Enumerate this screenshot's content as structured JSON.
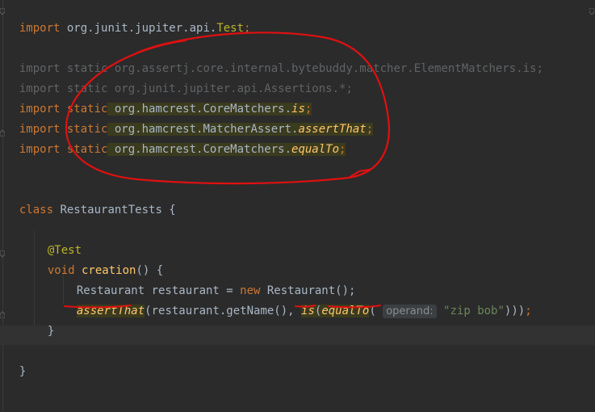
{
  "editor": {
    "lines": {
      "l1": {
        "kw": "import",
        "pkg": " org.junit.jupiter.api.",
        "cls": "Test",
        "semi": ";"
      },
      "l2": {
        "kw": "import static",
        "pkg": " org.assertj.core.internal.bytebuddy.matcher.ElementMatchers.is;"
      },
      "l3": {
        "kw": "import static",
        "pkg": " org.junit.jupiter.api.Assertions.*;"
      },
      "l4": {
        "kw": "import static",
        "pkg": " org.hamcrest.CoreMatchers.",
        "member": "is",
        "semi": ";"
      },
      "l5": {
        "kw": "import static",
        "pkg": " org.hamcrest.MatcherAssert.",
        "member": "assertThat",
        "semi": ";"
      },
      "l6": {
        "kw": "import static",
        "pkg": " org.hamcrest.CoreMatchers.",
        "member": "equalTo",
        "semi": ";"
      },
      "l7": {
        "kw": "class",
        "name": " RestaurantTests",
        "brace": " {"
      },
      "l8": {
        "ann": "@Test"
      },
      "l9": {
        "kw": "void",
        "fn": " creation",
        "rest": "() {"
      },
      "l10": {
        "a": "Restaurant restaurant = ",
        "kw": "new",
        "b": " Restaurant();"
      },
      "l11": {
        "fn1": "assertThat",
        "a": "(restaurant.getName(), ",
        "fn2": "is",
        "b": "(",
        "fn3": "equalTo",
        "c": "(",
        "hint": "operand:",
        "str": "\"zip bob\"",
        "d": ")))",
        "semi": ";"
      },
      "l12": {
        "brace": "}"
      },
      "l13": {
        "brace": "}"
      }
    }
  }
}
